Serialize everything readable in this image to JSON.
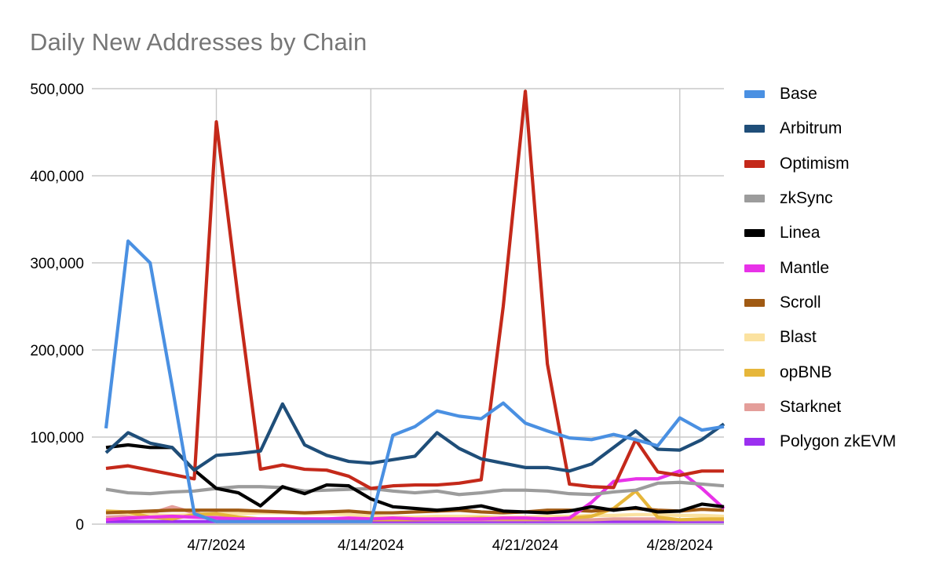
{
  "chart_data": {
    "type": "line",
    "title": "Daily New Addresses by Chain",
    "xlabel": "",
    "ylabel": "",
    "grid": true,
    "legend_position": "right",
    "ylim": [
      0,
      500000
    ],
    "ytick_labels": [
      "0",
      "100,000",
      "200,000",
      "300,000",
      "400,000",
      "500,000"
    ],
    "ytick_values": [
      0,
      100000,
      200000,
      300000,
      400000,
      500000
    ],
    "xtick_labels": [
      "4/7/2024",
      "4/14/2024",
      "4/21/2024",
      "4/28/2024"
    ],
    "xtick_indices": [
      5,
      12,
      19,
      26
    ],
    "x": [
      "4/2/2024",
      "4/3/2024",
      "4/4/2024",
      "4/5/2024",
      "4/6/2024",
      "4/7/2024",
      "4/8/2024",
      "4/9/2024",
      "4/10/2024",
      "4/11/2024",
      "4/12/2024",
      "4/13/2024",
      "4/14/2024",
      "4/15/2024",
      "4/16/2024",
      "4/17/2024",
      "4/18/2024",
      "4/19/2024",
      "4/20/2024",
      "4/21/2024",
      "4/22/2024",
      "4/23/2024",
      "4/24/2024",
      "4/25/2024",
      "4/26/2024",
      "4/27/2024",
      "4/28/2024",
      "4/29/2024",
      "4/30/2024"
    ],
    "series": [
      {
        "name": "Base",
        "color": "#4a90e2",
        "values": [
          110000,
          325000,
          300000,
          158000,
          12000,
          3000,
          3000,
          3000,
          3000,
          3000,
          3000,
          3000,
          3000,
          102000,
          112000,
          130000,
          124000,
          121000,
          139000,
          116000,
          107000,
          99000,
          97000,
          103000,
          97000,
          90000,
          122000,
          108000,
          112000
        ]
      },
      {
        "name": "Arbitrum",
        "color": "#1f4e79",
        "values": [
          82000,
          105000,
          93000,
          88000,
          62000,
          79000,
          81000,
          84000,
          138000,
          91000,
          79000,
          72000,
          70000,
          74000,
          78000,
          105000,
          87000,
          75000,
          70000,
          65000,
          65000,
          61000,
          69000,
          88000,
          107000,
          86000,
          85000,
          97000,
          115000
        ]
      },
      {
        "name": "Optimism",
        "color": "#c4291a",
        "values": [
          64000,
          67000,
          62000,
          57000,
          52000,
          462000,
          257000,
          63000,
          68000,
          63000,
          62000,
          55000,
          41000,
          44000,
          45000,
          45000,
          47000,
          51000,
          250000,
          497000,
          184000,
          46000,
          43000,
          42000,
          97000,
          60000,
          56000,
          61000,
          61000
        ]
      },
      {
        "name": "zkSync",
        "color": "#9c9c9c",
        "values": [
          40000,
          36000,
          35000,
          37000,
          38000,
          41000,
          43000,
          43000,
          42000,
          38000,
          39000,
          40000,
          41000,
          38000,
          36000,
          38000,
          34000,
          36000,
          39000,
          39000,
          38000,
          35000,
          34000,
          37000,
          39000,
          47000,
          48000,
          46000,
          44000
        ]
      },
      {
        "name": "Linea",
        "color": "#000000",
        "values": [
          88000,
          91000,
          88000,
          88000,
          62000,
          41000,
          36000,
          21000,
          43000,
          35000,
          45000,
          44000,
          29000,
          20000,
          18000,
          16000,
          18000,
          21000,
          15000,
          14000,
          13000,
          15000,
          20000,
          16000,
          19000,
          14000,
          15000,
          23000,
          20000
        ]
      },
      {
        "name": "Mantle",
        "color": "#e832e8",
        "values": [
          5000,
          7000,
          8000,
          9000,
          8000,
          7000,
          6000,
          6000,
          6000,
          6000,
          6000,
          7000,
          6000,
          7000,
          6000,
          6000,
          6000,
          6000,
          7000,
          7000,
          6000,
          7000,
          25000,
          49000,
          52000,
          52000,
          61000,
          41000,
          18000
        ]
      },
      {
        "name": "Scroll",
        "color": "#a05a13",
        "values": [
          13000,
          14000,
          15000,
          16000,
          16000,
          16000,
          16000,
          15000,
          14000,
          13000,
          14000,
          15000,
          13000,
          13000,
          14000,
          15000,
          16000,
          14000,
          13000,
          14000,
          16000,
          16000,
          15000,
          17000,
          18000,
          16000,
          15000,
          17000,
          16000
        ]
      },
      {
        "name": "Blast",
        "color": "#fbe2a0",
        "values": [
          14000,
          12000,
          11000,
          10000,
          11000,
          12000,
          12000,
          13000,
          13000,
          12000,
          12000,
          11000,
          9000,
          8000,
          8000,
          9000,
          9000,
          9000,
          8000,
          8000,
          9000,
          9000,
          10000,
          10000,
          11000,
          11000,
          10000,
          10000,
          9000
        ]
      },
      {
        "name": "opBNB",
        "color": "#e6b63a",
        "values": [
          15000,
          14000,
          8000,
          6000,
          11000,
          12000,
          8000,
          6000,
          6000,
          6000,
          6000,
          5000,
          5000,
          5000,
          5000,
          6000,
          6000,
          7000,
          6000,
          6000,
          6000,
          7000,
          9000,
          18000,
          38000,
          8000,
          5000,
          6000,
          6000
        ]
      },
      {
        "name": "Starknet",
        "color": "#e49e9a",
        "values": [
          8000,
          9000,
          12000,
          20000,
          13000,
          8000,
          7000,
          6000,
          6000,
          5000,
          5000,
          5000,
          5000,
          5000,
          5000,
          5000,
          5000,
          5000,
          5000,
          5000,
          5000,
          5000,
          5000,
          6000,
          6000,
          6000,
          5000,
          5000,
          5000
        ]
      },
      {
        "name": "Polygon zkEVM",
        "color": "#9b30f0",
        "values": [
          3000,
          3000,
          3000,
          3000,
          3000,
          3000,
          3000,
          3000,
          3000,
          3000,
          3000,
          3000,
          3000,
          3000,
          3000,
          3000,
          3000,
          3000,
          3000,
          3000,
          3000,
          3000,
          3000,
          3000,
          3000,
          3000,
          3000,
          3000,
          3000
        ]
      }
    ]
  },
  "legend": {
    "items": [
      {
        "label": "Base",
        "color": "#4a90e2"
      },
      {
        "label": "Arbitrum",
        "color": "#1f4e79"
      },
      {
        "label": "Optimism",
        "color": "#c4291a"
      },
      {
        "label": "zkSync",
        "color": "#9c9c9c"
      },
      {
        "label": "Linea",
        "color": "#000000"
      },
      {
        "label": "Mantle",
        "color": "#e832e8"
      },
      {
        "label": "Scroll",
        "color": "#a05a13"
      },
      {
        "label": "Blast",
        "color": "#fbe2a0"
      },
      {
        "label": "opBNB",
        "color": "#e6b63a"
      },
      {
        "label": "Starknet",
        "color": "#e49e9a"
      },
      {
        "label": "Polygon zkEVM",
        "color": "#9b30f0"
      }
    ]
  },
  "style": {
    "title_color": "#767676",
    "gridline_color": "#c8c8c8",
    "background": "#ffffff"
  }
}
